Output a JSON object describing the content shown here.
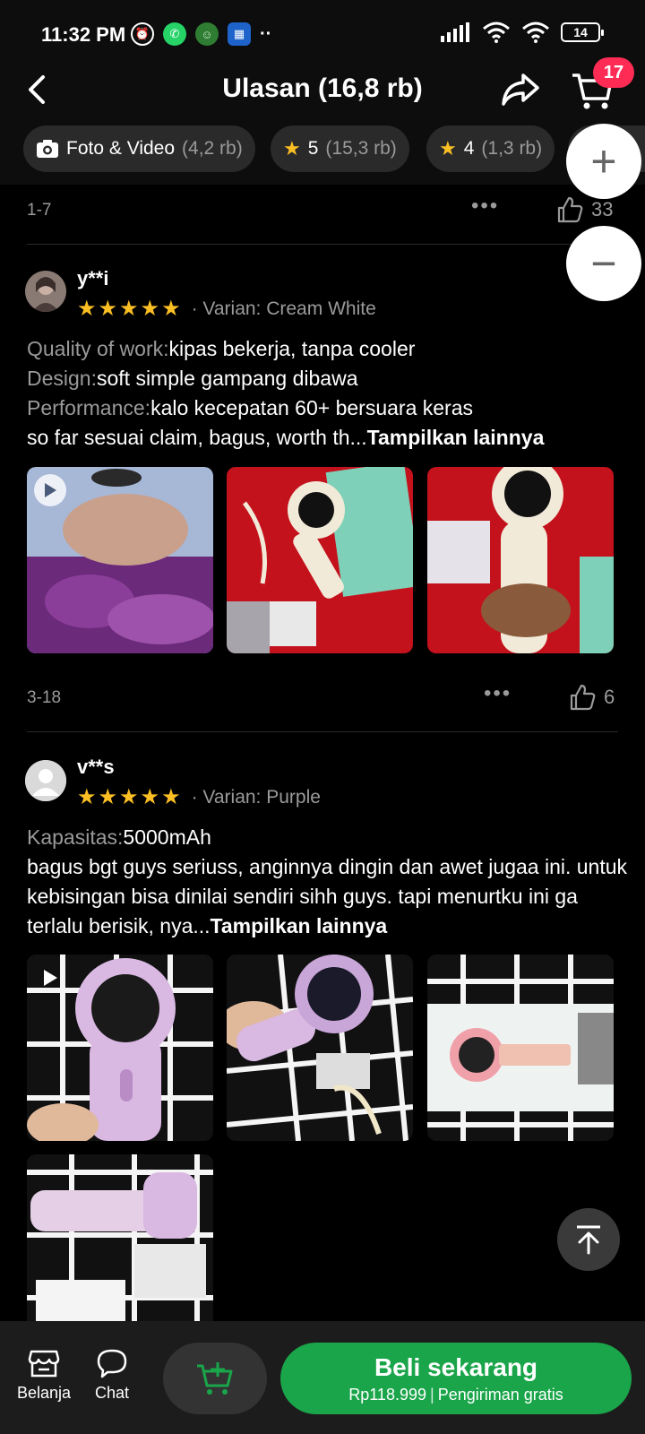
{
  "status_bar": {
    "time": "11:32 PM",
    "battery": "14"
  },
  "header": {
    "title": "Ulasan (16,8 rb)",
    "cart_count": "17"
  },
  "filters": [
    {
      "label": "Foto & Video",
      "count": "(4,2 rb)"
    },
    {
      "label": "5",
      "count": "(15,3 rb)"
    },
    {
      "label": "4",
      "count": "(1,3 rb)"
    }
  ],
  "prev_review": {
    "date": "1-7",
    "likes": "33"
  },
  "reviews": [
    {
      "user": "y**i",
      "rating": 5,
      "variant": "Varian: Cream White",
      "lines": [
        {
          "key": "Quality of work:",
          "value": "kipas bekerja, tanpa cooler"
        },
        {
          "key": "Design:",
          "value": "soft simple gampang dibawa"
        },
        {
          "key": "Performance:",
          "value": "kalo kecepatan 60+ bersuara keras"
        }
      ],
      "body": "so far sesuai claim, bagus, worth th...",
      "more": "Tampilkan lainnya",
      "date": "3-18",
      "likes": "6"
    },
    {
      "user": "v**s",
      "rating": 5,
      "variant": "Varian: Purple",
      "lines": [
        {
          "key": "Kapasitas:",
          "value": "5000mAh"
        }
      ],
      "body": "bagus bgt guys seriuss, anginnya dingin dan awet jugaa ini. untuk kebisingan bisa dinilai sendiri sihh guys. tapi menurtku ini ga terlalu berisik, nya...",
      "more": "Tampilkan lainnya"
    }
  ],
  "bottom_bar": {
    "shop_label": "Belanja",
    "chat_label": "Chat",
    "buy_label": "Beli sekarang",
    "price": "Rp118.999",
    "shipping": "Pengiriman gratis"
  }
}
